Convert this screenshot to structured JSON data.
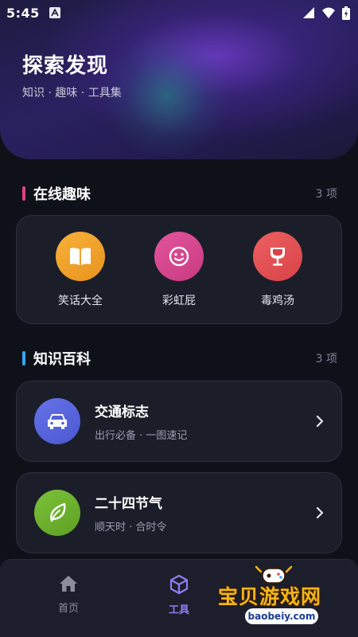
{
  "status_bar": {
    "time": "5:45"
  },
  "header": {
    "title": "探索发现",
    "subtitle": "知识 · 趣味 · 工具集"
  },
  "sections": [
    {
      "title": "在线趣味",
      "count": "3 项",
      "accent": "#e0427f",
      "items": [
        {
          "label": "笑话大全",
          "icon": "book-icon",
          "color": "#f0a52a"
        },
        {
          "label": "彩虹屁",
          "icon": "smiley-icon",
          "color": "#d6458f"
        },
        {
          "label": "毒鸡汤",
          "icon": "goblet-icon",
          "color": "#e25354"
        }
      ]
    },
    {
      "title": "知识百科",
      "count": "3 项",
      "accent": "#3aa7f0",
      "items": [
        {
          "title": "交通标志",
          "subtitle": "出行必备 · 一图速记",
          "icon": "car-icon",
          "color": "#5a68e0"
        },
        {
          "title": "二十四节气",
          "subtitle": "顺天时 · 合时令",
          "icon": "leaf-icon",
          "color": "#6fb22e"
        }
      ]
    }
  ],
  "bottom_nav": {
    "items": [
      {
        "label": "首页",
        "icon": "home-icon",
        "active": false
      },
      {
        "label": "工具",
        "icon": "cube-icon",
        "active": true
      }
    ],
    "active_color": "#8f7cf4",
    "inactive_color": "#8a8d9c"
  },
  "watermark": {
    "text": "宝贝游戏网",
    "url": "baobeiy.com"
  }
}
